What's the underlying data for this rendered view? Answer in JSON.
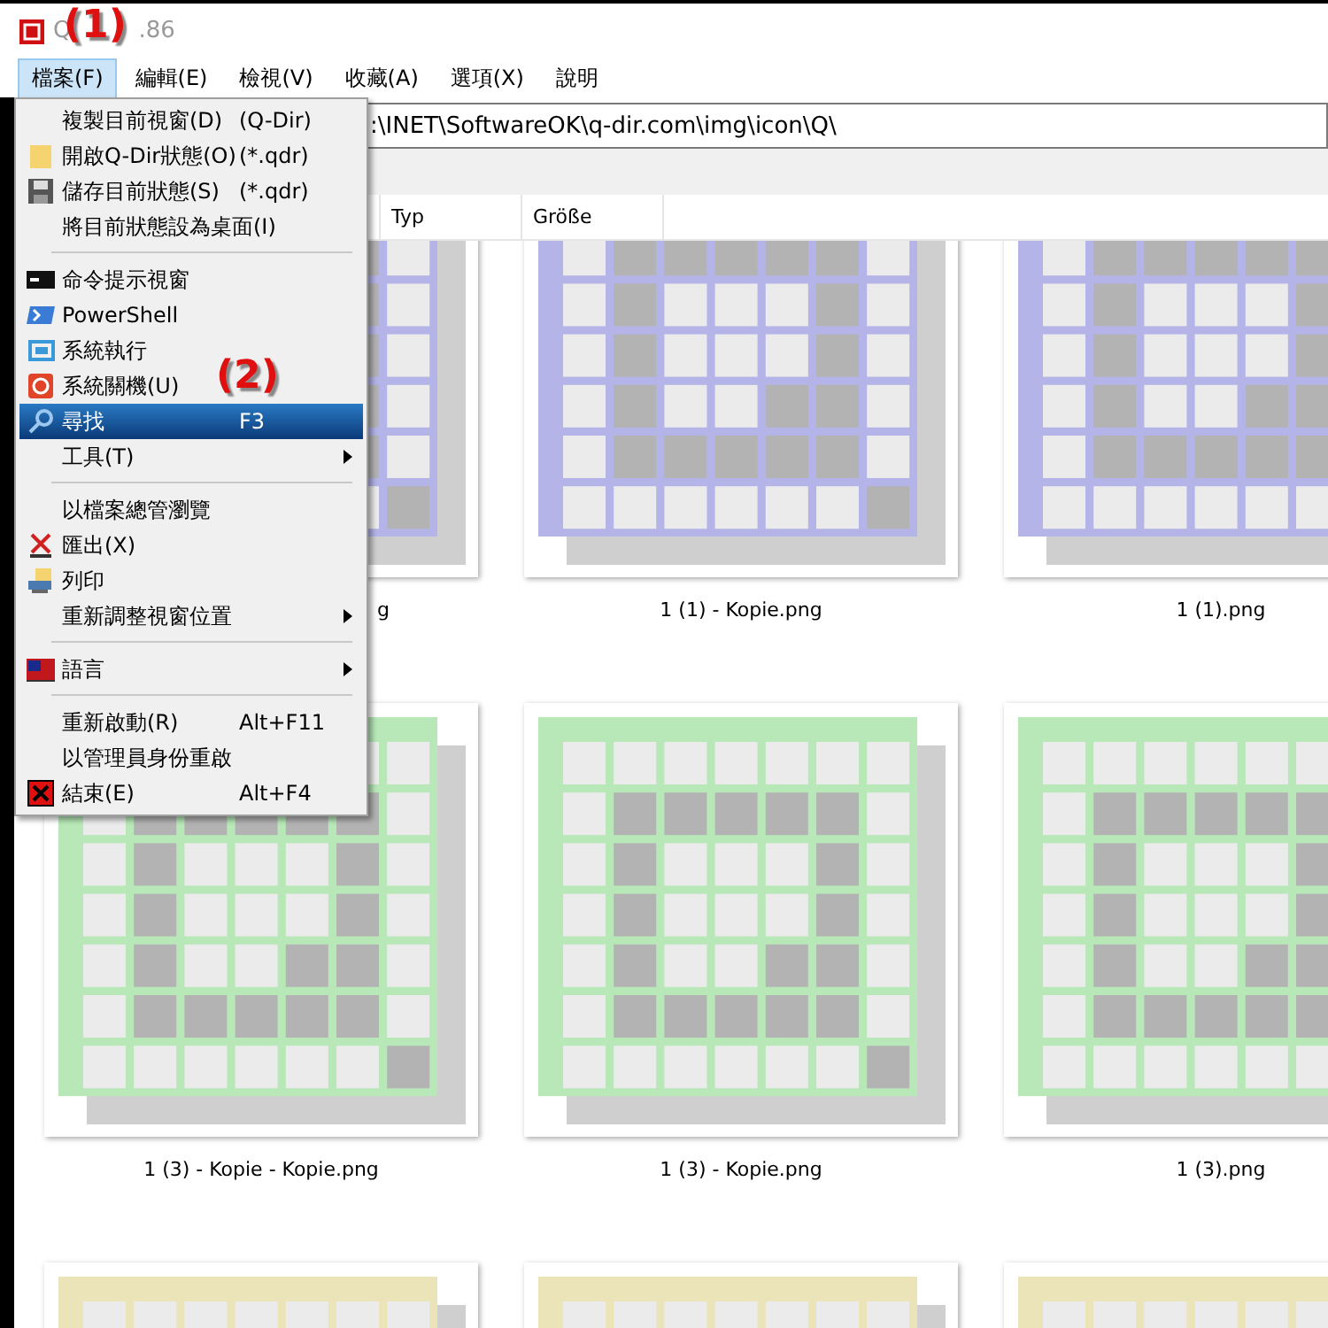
{
  "window": {
    "title_start": "Q",
    "title_end": ".86"
  },
  "annotations": [
    {
      "label": "(1)"
    },
    {
      "label": "(2)"
    }
  ],
  "menubar": [
    {
      "label": "檔案(F)",
      "selected": true
    },
    {
      "label": "編輯(E)",
      "selected": false
    },
    {
      "label": "檢視(V)",
      "selected": false
    },
    {
      "label": "收藏(A)",
      "selected": false
    },
    {
      "label": "選項(X)",
      "selected": false
    },
    {
      "label": "說明",
      "selected": false
    }
  ],
  "address": {
    "value": ":\\INET\\SoftwareOK\\q-dir.com\\img\\icon\\Q\\"
  },
  "columns": [
    "Typ",
    "Größe"
  ],
  "files": [
    {
      "name": "g",
      "cut": true,
      "color": "#b4b4e8"
    },
    {
      "name": "1 (1) - Kopie.png",
      "color": "#b4b4e8"
    },
    {
      "name": "1 (1).png",
      "color": "#b4b4e8"
    },
    {
      "name": "1 (3) - Kopie - Kopie.png",
      "color": "#b8e8b8"
    },
    {
      "name": "1 (3) - Kopie.png",
      "color": "#b8e8b8"
    },
    {
      "name": "1 (3).png",
      "color": "#b8e8b8"
    },
    {
      "color": "#ebe4b8"
    },
    {
      "color": "#ebe4b8"
    },
    {
      "color": "#ebe4b8"
    }
  ],
  "menu": [
    {
      "kind": "item",
      "label": "複製目前視窗(D)",
      "shortcut": "(Q-Dir)",
      "selected": false
    },
    {
      "kind": "item",
      "label": "開啟Q-Dir狀態(O)",
      "shortcut": "(*.qdr)",
      "selected": false
    },
    {
      "kind": "item",
      "label": "儲存目前狀態(S)",
      "shortcut": "(*.qdr)",
      "selected": false
    },
    {
      "kind": "item",
      "label": "將目前狀態設為桌面(I)",
      "selected": false
    },
    {
      "kind": "separator"
    },
    {
      "kind": "item",
      "label": "命令提示視窗",
      "selected": false
    },
    {
      "kind": "item",
      "label": "PowerShell",
      "selected": false
    },
    {
      "kind": "item",
      "label": "系統執行",
      "selected": false
    },
    {
      "kind": "item",
      "label": "系統關機(U)",
      "selected": false
    },
    {
      "kind": "item",
      "label": "尋找",
      "shortcut": "F3",
      "selected": true
    },
    {
      "kind": "item",
      "label": "工具(T)",
      "submenu": true,
      "selected": false
    },
    {
      "kind": "separator"
    },
    {
      "kind": "item",
      "label": "以檔案總管瀏覽",
      "selected": false
    },
    {
      "kind": "item",
      "label": "匯出(X)",
      "selected": false
    },
    {
      "kind": "item",
      "label": "列印",
      "selected": false
    },
    {
      "kind": "item",
      "label": "重新調整視窗位置",
      "submenu": true,
      "selected": false
    },
    {
      "kind": "separator"
    },
    {
      "kind": "item",
      "label": "語言",
      "submenu": true,
      "selected": false
    },
    {
      "kind": "separator"
    },
    {
      "kind": "item",
      "label": "重新啟動(R)",
      "shortcut": "Alt+F11",
      "selected": false
    },
    {
      "kind": "item",
      "label": "以管理員身份重啟",
      "selected": false
    },
    {
      "kind": "item",
      "label": "結束(E)",
      "shortcut": "Alt+F4",
      "selected": false
    }
  ]
}
